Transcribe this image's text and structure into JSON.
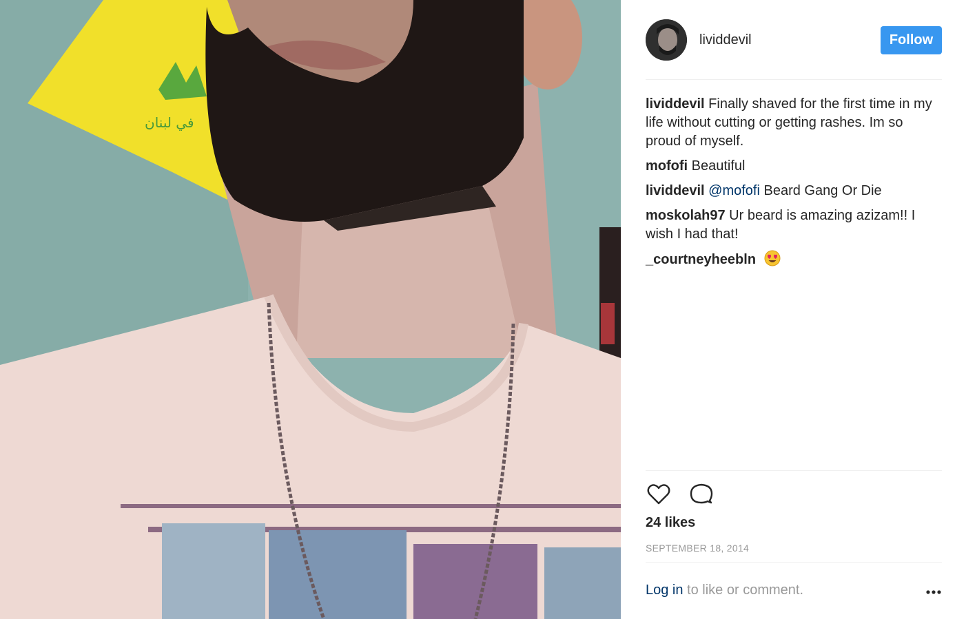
{
  "post": {
    "header": {
      "username": "lividdevil",
      "follow_label": "Follow"
    },
    "photo": {
      "flag_text": "في لبنان",
      "icon": "beard-selfie-photo"
    },
    "comments": [
      {
        "user": "lividdevil",
        "text": "Finally shaved for the first time in my life without cutting or getting rashes. Im so proud of myself."
      },
      {
        "user": "mofofi",
        "text": "Beautiful"
      },
      {
        "user": "lividdevil",
        "mention": "@mofofi",
        "text": "Beard Gang Or Die"
      },
      {
        "user": "moskolah97",
        "text": "Ur beard is amazing azizam!! I wish I had that!"
      },
      {
        "user": "_courtneyheebln",
        "text": "",
        "emoji": "heart-eyes-emoji"
      }
    ],
    "actions": {
      "like_icon": "heart-icon",
      "comment_icon": "comment-bubble-icon"
    },
    "likes_text": "24 likes",
    "date_text": "SEPTEMBER 18, 2014",
    "footer": {
      "login_label": "Log in",
      "login_suffix": " to like or comment.",
      "more_icon": "more-options-icon"
    },
    "colors": {
      "follow_bg": "#3897f0",
      "link": "#003569",
      "muted": "#999999",
      "wall": "#8fb4b0",
      "flag": "#f2e12b"
    }
  }
}
